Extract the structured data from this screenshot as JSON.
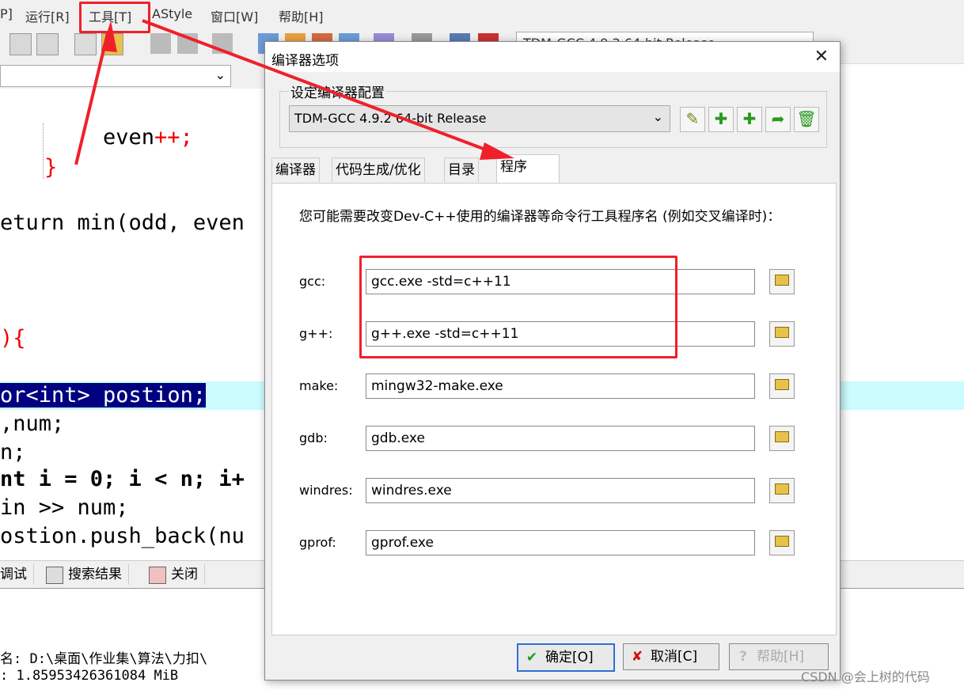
{
  "menu": {
    "items": [
      "P]",
      "运行[R]",
      "工具[T]",
      "AStyle",
      "窗口[W]",
      "帮助[H]"
    ]
  },
  "compiler_combo_bg": "TDM-GCC 4.9.2 64-bit Release",
  "editor": {
    "lines": [
      {
        "text": "even",
        "suffix": "++;"
      },
      {
        "text": "}"
      },
      {
        "text": "eturn min(odd, even"
      },
      {
        "text": "){"
      },
      {
        "text": "or<int> postion;"
      },
      {
        "text": ",num;"
      },
      {
        "text": "n;"
      },
      {
        "text": "nt i = 0; i < n; i+"
      },
      {
        "text": "in >> num;"
      },
      {
        "text": "ostion.push_back(nu"
      }
    ]
  },
  "bottom_tabs": [
    "调试",
    "搜索结果",
    "关闭"
  ],
  "log_lines": [
    "名: D:\\桌面\\作业集\\算法\\力扣\\",
    ": 1.85953426361084 MiB"
  ],
  "dialog": {
    "title": "编译器选项",
    "group_label": "设定编译器配置",
    "compiler_select": "TDM-GCC 4.9.2 64-bit Release",
    "tabs": [
      "编译器",
      "代码生成/优化",
      "目录",
      "程序"
    ],
    "active_tab": "程序",
    "description": "您可能需要改变Dev-C++使用的编译器等命令行工具程序名 (例如交叉编译时)：",
    "programs": [
      {
        "label": "gcc:",
        "value": "gcc.exe -std=c++11"
      },
      {
        "label": "g++:",
        "value": "g++.exe -std=c++11"
      },
      {
        "label": "make:",
        "value": "mingw32-make.exe"
      },
      {
        "label": "gdb:",
        "value": "gdb.exe"
      },
      {
        "label": "windres:",
        "value": "windres.exe"
      },
      {
        "label": "gprof:",
        "value": "gprof.exe"
      }
    ],
    "buttons": {
      "ok": "确定[O]",
      "cancel": "取消[C]",
      "help": "帮助[H]"
    }
  },
  "watermark": "CSDN @会上树的代码",
  "colors": {
    "annotation_red": "#f0202a",
    "selection": "#000080",
    "current_line": "#cdfcff"
  }
}
